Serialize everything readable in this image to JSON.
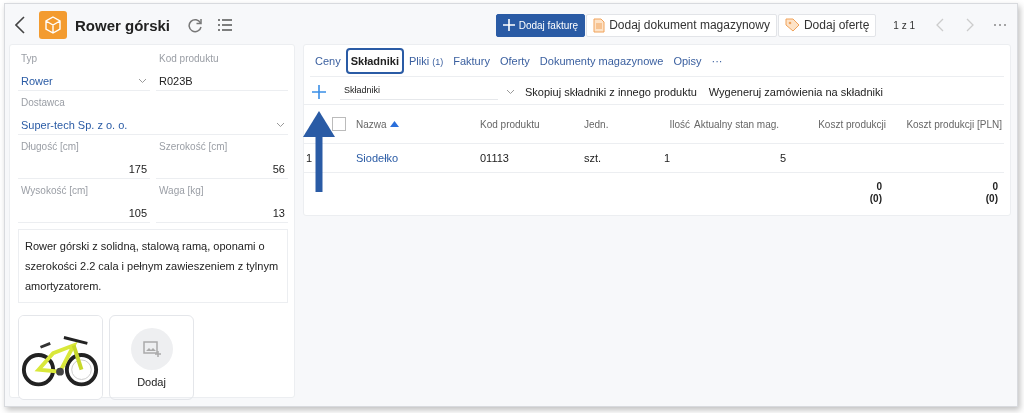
{
  "header": {
    "title": "Rower górski",
    "actions": [
      {
        "kind": "primary",
        "label": "Dodaj fakturę"
      },
      {
        "kind": "document",
        "label": "Dodaj dokument magazynowy"
      },
      {
        "kind": "tag",
        "label": "Dodaj ofertę"
      }
    ],
    "pager": "1 z 1"
  },
  "details": {
    "field_rows": [
      [
        {
          "label": "Typ",
          "value": "Rower",
          "kind": "select"
        },
        {
          "label": "Kod produktu",
          "value": "R023B",
          "kind": "text"
        }
      ],
      [
        {
          "label": "Dostawca",
          "value": "Super-tech Sp. z o. o.",
          "kind": "select"
        }
      ],
      [
        {
          "label": "Długość [cm]",
          "value": "175",
          "kind": "number"
        },
        {
          "label": "Szerokość [cm]",
          "value": "56",
          "kind": "number"
        }
      ],
      [
        {
          "label": "Wysokość [cm]",
          "value": "105",
          "kind": "number"
        },
        {
          "label": "Waga [kg]",
          "value": "13",
          "kind": "number"
        }
      ]
    ],
    "description": "Rower górski z solidną, stalową ramą, oponami o szerokości 2.2 cala i pełnym zawieszeniem z tylnym amortyzatorem.",
    "images": [
      {
        "kind": "picture"
      },
      {
        "kind": "add",
        "label": "Dodaj"
      }
    ]
  },
  "tabs": [
    {
      "label": "Ceny",
      "selected": false
    },
    {
      "label": "Składniki",
      "selected": true
    },
    {
      "label": "Pliki",
      "count": "(1)",
      "selected": false
    },
    {
      "label": "Faktury",
      "selected": false
    },
    {
      "label": "Oferty",
      "selected": false
    },
    {
      "label": "Dokumenty magazynowe",
      "selected": false
    },
    {
      "label": "Opisy",
      "selected": false
    },
    {
      "label": "···",
      "selected": false
    }
  ],
  "toolbar": {
    "select": "Składniki",
    "actions": [
      "Skopiuj składniki z innego produktu",
      "Wygeneruj zamówienia na składniki"
    ]
  },
  "table": {
    "select_all_checked": false,
    "columns": [
      {
        "label": "Nazwa",
        "sorted": true
      },
      {
        "label": "Kod produktu"
      },
      {
        "label": "Jedn."
      },
      {
        "label": "Ilość"
      },
      {
        "label": "Aktualny stan mag."
      },
      {
        "label": "Koszt produkcji"
      },
      {
        "label": "Koszt produkcji [PLN]"
      }
    ],
    "rows": [
      {
        "number": "1",
        "cells": [
          "Siodełko",
          "01113",
          "szt.",
          "1",
          "5"
        ]
      }
    ],
    "totals": [
      {
        "value": "0",
        "sub": "(0)"
      },
      {
        "value": "0",
        "sub": "(0)"
      }
    ]
  }
}
